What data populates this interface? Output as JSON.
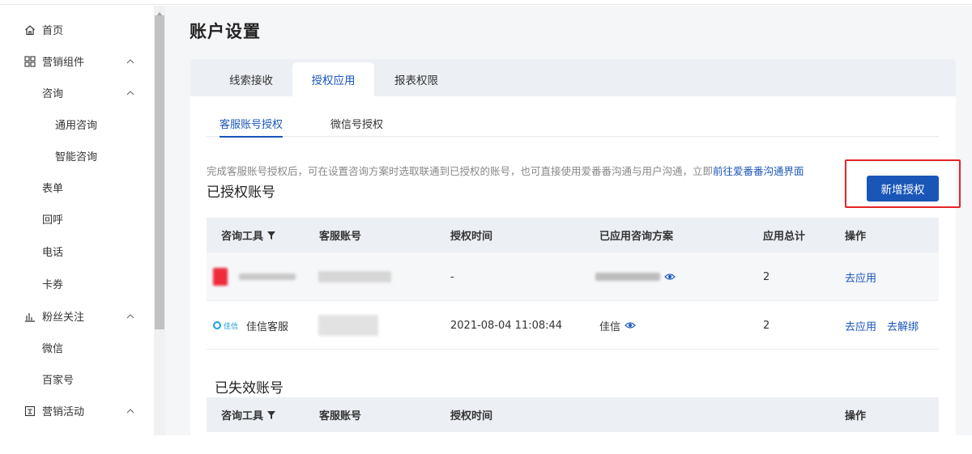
{
  "sidebar": {
    "items": [
      {
        "label": "首页",
        "icon": "home-icon"
      },
      {
        "label": "营销组件",
        "icon": "grid-icon",
        "expanded": true
      },
      {
        "label": "咨询",
        "expanded": true
      },
      {
        "label": "通用咨询"
      },
      {
        "label": "智能咨询"
      },
      {
        "label": "表单"
      },
      {
        "label": "回呼"
      },
      {
        "label": "电话"
      },
      {
        "label": "卡券"
      },
      {
        "label": "粉丝关注",
        "icon": "bar-chart-icon",
        "expanded": true
      },
      {
        "label": "微信"
      },
      {
        "label": "百家号"
      },
      {
        "label": "营销活动",
        "icon": "gift-icon",
        "expanded": true
      }
    ]
  },
  "page": {
    "title": "账户设置"
  },
  "tabs": {
    "items": [
      "线索接收",
      "授权应用",
      "报表权限"
    ],
    "active": "授权应用"
  },
  "subtabs": {
    "items": [
      "客服账号授权",
      "微信号授权"
    ],
    "active": "客服账号授权"
  },
  "notice": {
    "text": "完成客服账号授权后，可在设置咨询方案时选取联通到已授权的账号，也可直接使用爱番番沟通与用户沟通，立即",
    "link": "前往爱番番沟通界面"
  },
  "authorized": {
    "title": "已授权账号",
    "add_button": "新增授权",
    "headers": [
      "咨询工具",
      "客服账号",
      "授权时间",
      "已应用咨询方案",
      "应用总计",
      "操作"
    ],
    "rows": [
      {
        "tool": "",
        "account": "",
        "time": "-",
        "plan": "",
        "total": "2",
        "actions": [
          "去应用"
        ]
      },
      {
        "tool_logo": "佳信",
        "tool": "佳信客服",
        "account": "",
        "time": "2021-08-04 11:08:44",
        "plan": "佳信",
        "total": "2",
        "actions": [
          "去应用",
          "去解绑"
        ]
      }
    ]
  },
  "expired": {
    "title": "已失效账号",
    "headers": [
      "咨询工具",
      "客服账号",
      "授权时间",
      "操作"
    ]
  },
  "colors": {
    "primary": "#1a56b8",
    "highlight": "#e52424",
    "table_header_bg": "#eceff4"
  }
}
